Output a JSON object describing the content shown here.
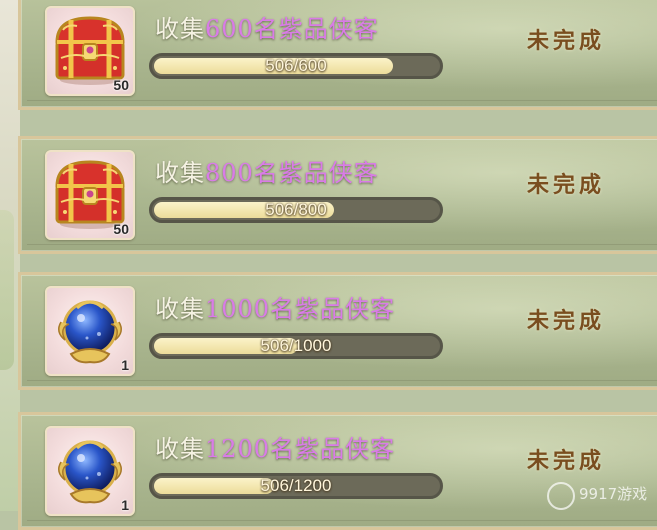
{
  "rows": [
    {
      "prefix": "收集",
      "number": "600",
      "suffix": "名紫品侠客",
      "progress": "506/600",
      "fraction": 0.8433,
      "status": "未完成",
      "item": "chest",
      "quantity": "50"
    },
    {
      "prefix": "收集",
      "number": "800",
      "suffix": "名紫品侠客",
      "progress": "506/800",
      "fraction": 0.6325,
      "status": "未完成",
      "item": "chest",
      "quantity": "50"
    },
    {
      "prefix": "收集",
      "number": "1000",
      "suffix": "名紫品侠客",
      "progress": "506/1000",
      "fraction": 0.506,
      "status": "未完成",
      "item": "orb",
      "quantity": "1"
    },
    {
      "prefix": "收集",
      "number": "1200",
      "suffix": "名紫品侠客",
      "progress": "506/1200",
      "fraction": 0.4217,
      "status": "未完成",
      "item": "orb",
      "quantity": "1"
    }
  ],
  "watermark": "9917游戏",
  "colors": {
    "highlight": "#d97be7",
    "status": "#7a4e1f",
    "bar_fill": "#ecdc9a"
  }
}
